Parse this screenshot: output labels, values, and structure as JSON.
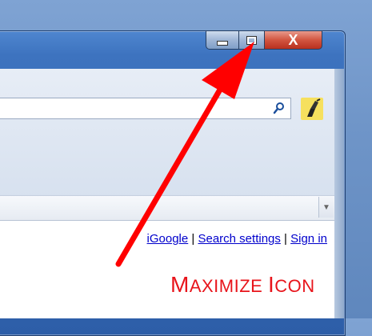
{
  "window": {
    "caption_buttons": {
      "minimize_icon": "minimize-icon",
      "maximize_icon": "maximize-icon",
      "close_label": "X"
    }
  },
  "search": {
    "value": "",
    "icon": "search-icon",
    "extra_icon": "highlighter-icon"
  },
  "links": {
    "igoogle": "iGoogle",
    "search_settings": "Search settings",
    "sign_in": "Sign in",
    "separator": "|"
  },
  "annotation": {
    "m": "M",
    "aximize": "AXIMIZE",
    "i": "I",
    "con": "CON"
  },
  "colors": {
    "annotation_red": "#e8141b",
    "link_blue": "#0000cc"
  }
}
